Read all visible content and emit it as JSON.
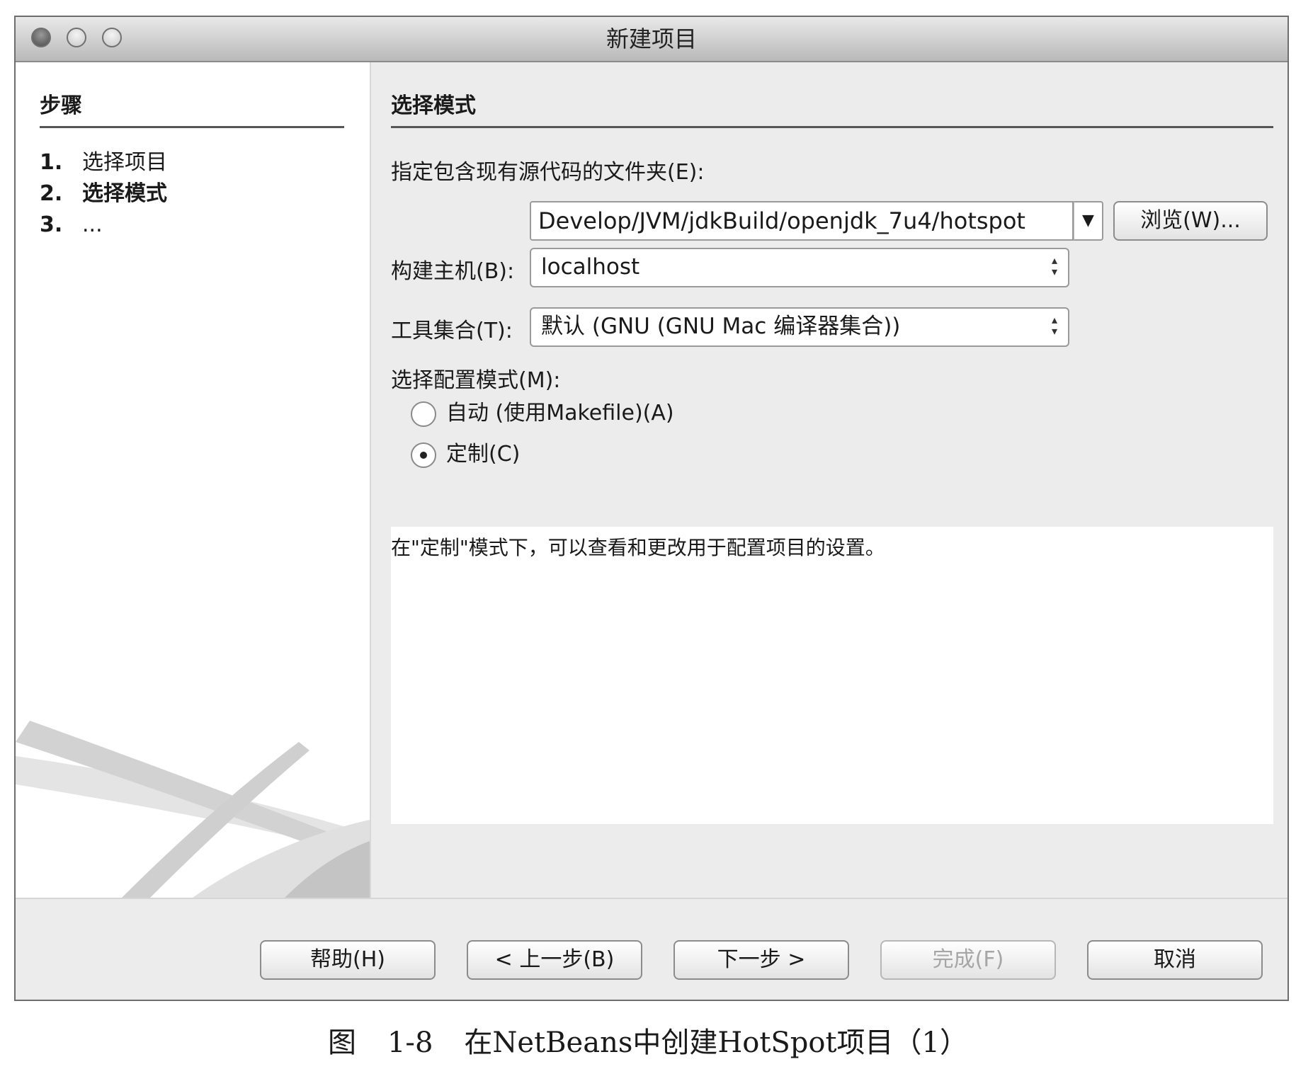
{
  "window": {
    "title": "新建项目"
  },
  "steps": {
    "header": "步骤",
    "items": [
      {
        "num": "1.",
        "label": "选择项目"
      },
      {
        "num": "2.",
        "label": "选择模式"
      },
      {
        "num": "3.",
        "label": "..."
      }
    ],
    "current_index": 1
  },
  "content": {
    "section_title": "选择模式",
    "source_folder_label": "指定包含现有源代码的文件夹(E):",
    "source_folder_value": "Develop/JVM/jdkBuild/openjdk_7u4/hotspot",
    "browse_button": "浏览(W)...",
    "build_host_label": "构建主机(B):",
    "build_host_value": "localhost",
    "tool_collection_label": "工具集合(T):",
    "tool_collection_value": "默认 (GNU (GNU Mac 编译器集合))",
    "config_mode_label": "选择配置模式(M):",
    "radio_auto": "自动 (使用Makefile)(A)",
    "radio_custom": "定制(C)",
    "selected_mode": "custom",
    "description": "在\"定制\"模式下，可以查看和更改用于配置项目的设置。"
  },
  "buttons": {
    "help": "帮助(H)",
    "back": "< 上一步(B)",
    "next": "下一步 >",
    "finish": "完成(F)",
    "cancel": "取消"
  },
  "caption": {
    "label": "图",
    "number": "1-8",
    "text": "在NetBeans中创建HotSpot项目（1）"
  }
}
